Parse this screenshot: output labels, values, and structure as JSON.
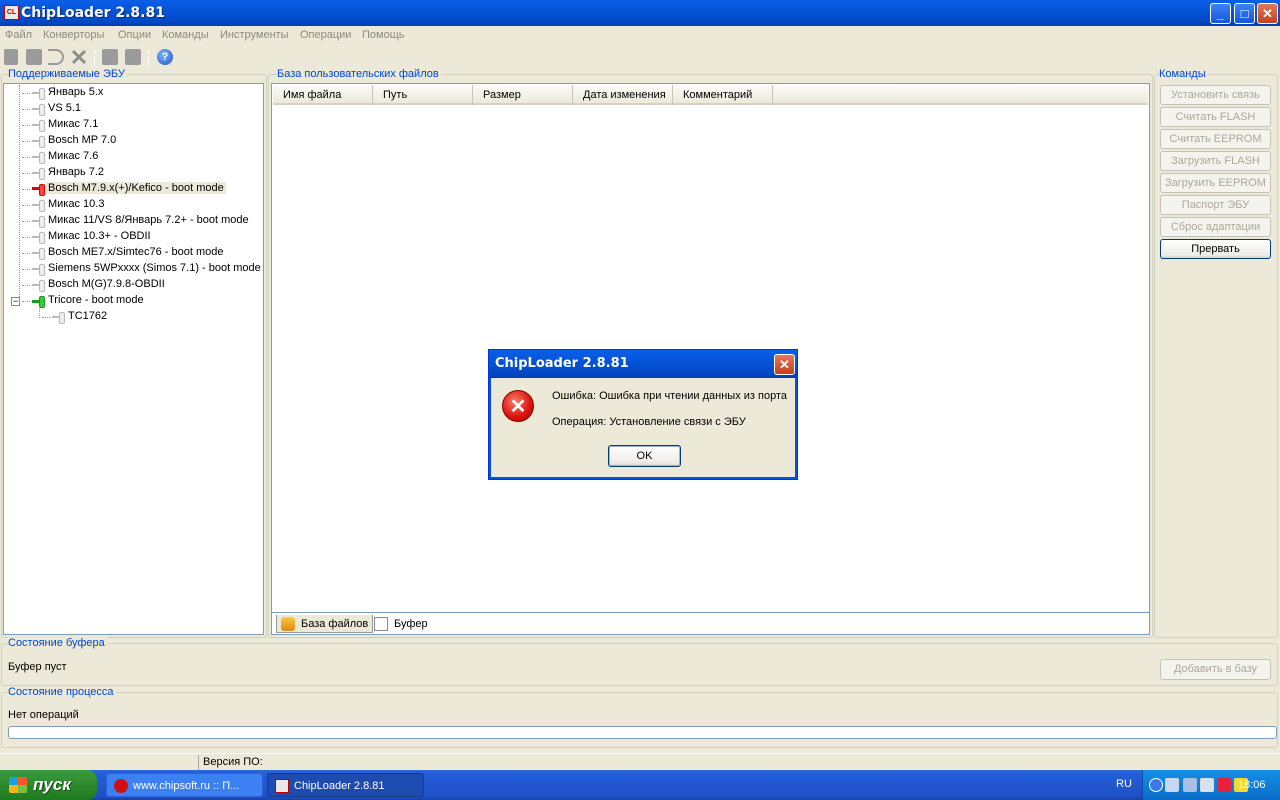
{
  "window": {
    "title": "ChipLoader 2.8.81",
    "icon": "chiploader-app-icon"
  },
  "menu": [
    "Файл",
    "Конверторы",
    "Опции",
    "Команды",
    "Инструменты",
    "Операции",
    "Помощь"
  ],
  "toolbar": {
    "icons": [
      "connect-icon",
      "disk-icon",
      "undo-icon",
      "tools-icon",
      "read-icon",
      "write-icon",
      "help-icon"
    ]
  },
  "ecu_panel": {
    "title": "Поддерживаемые ЭБУ",
    "items": [
      {
        "label": "Январь 5.x"
      },
      {
        "label": "VS 5.1"
      },
      {
        "label": "Микас 7.1"
      },
      {
        "label": "Bosch MP 7.0"
      },
      {
        "label": "Микас 7.6"
      },
      {
        "label": "Январь 7.2"
      },
      {
        "label": "Bosch M7.9.x(+)/Kefico - boot mode"
      },
      {
        "label": "Микас 10.3"
      },
      {
        "label": "Микас 11/VS 8/Январь 7.2+ - boot mode"
      },
      {
        "label": "Микас 10.3+ - OBDII"
      },
      {
        "label": "Bosch ME7.x/Simtec76 - boot mode"
      },
      {
        "label": "Siemens 5WPxxxx (Simos 7.1) - boot mode"
      },
      {
        "label": "Bosch M(G)7.9.8-OBDII"
      },
      {
        "label": "Tricore - boot mode"
      },
      {
        "label": "TC1762"
      }
    ],
    "selected_index": 6
  },
  "files_panel": {
    "title": "База пользовательских файлов",
    "columns": [
      "Имя файла",
      "Путь",
      "Размер",
      "Дата изменения",
      "Комментарий"
    ],
    "rows": [],
    "tabs": [
      {
        "label": "База файлов",
        "icon": "database-icon"
      },
      {
        "label": "Буфер",
        "icon": "buffer-icon"
      }
    ],
    "active_tab": 0
  },
  "commands": {
    "title": "Команды",
    "buttons": [
      {
        "label": "Установить связь",
        "enabled": false
      },
      {
        "label": "Считать FLASH",
        "enabled": false
      },
      {
        "label": "Считать EEPROM",
        "enabled": false
      },
      {
        "label": "Загрузить FLASH",
        "enabled": false
      },
      {
        "label": "Загрузить EEPROM",
        "enabled": false
      },
      {
        "label": "Паспорт ЭБУ",
        "enabled": false
      },
      {
        "label": "Сброс адаптации",
        "enabled": false
      },
      {
        "label": "Прервать",
        "enabled": true
      }
    ]
  },
  "buffer_state": {
    "title": "Состояние буфера",
    "text": "Буфер пуст",
    "add_button": "Добавить в базу"
  },
  "process_state": {
    "title": "Состояние процесса",
    "text": "Нет операций",
    "progress": 0
  },
  "statusbar": {
    "version_label": "Версия ПО:"
  },
  "dialog": {
    "title": "ChipLoader 2.8.81",
    "error_line": "Ошибка: Ошибка при чтении данных из порта",
    "operation_line": "Операция: Установление связи с ЭБУ",
    "ok_label": "OK"
  },
  "taskbar": {
    "start_label": "пуск",
    "tasks": [
      {
        "label": "www.chipsoft.ru :: П...",
        "active": false,
        "icon": "opera-icon"
      },
      {
        "label": "ChipLoader 2.8.81",
        "active": true,
        "icon": "chiploader-icon"
      }
    ],
    "language": "RU",
    "clock": "18:06"
  },
  "colors": {
    "accent": "#0046d5",
    "titlebar": "#0454d8",
    "face": "#ece9d8",
    "error": "#d8120a"
  }
}
